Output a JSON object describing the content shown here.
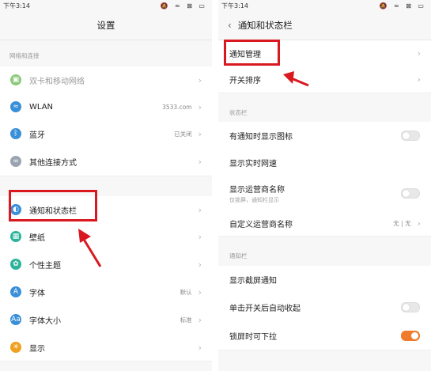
{
  "left": {
    "status": {
      "time": "下午3:14",
      "icons": "🔕 ≈ ⊠ ▭"
    },
    "title": "设置",
    "section_network": "网络和连接",
    "items": [
      {
        "label": "双卡和移动网络",
        "value": "",
        "icon": "sim-icon",
        "color": "#8cc97a"
      },
      {
        "label": "WLAN",
        "value": "3533.com",
        "icon": "wifi-icon",
        "color": "#3a8fd9"
      },
      {
        "label": "蓝牙",
        "value": "已关闭",
        "icon": "bluetooth-icon",
        "color": "#3a8fd9"
      },
      {
        "label": "其他连接方式",
        "value": "",
        "icon": "link-icon",
        "color": "#9aa4b0"
      },
      {
        "label": "通知和状态栏",
        "value": "",
        "icon": "notification-icon",
        "color": "#3a8fd9"
      },
      {
        "label": "壁纸",
        "value": "",
        "icon": "wallpaper-icon",
        "color": "#2cb39a"
      },
      {
        "label": "个性主题",
        "value": "",
        "icon": "theme-icon",
        "color": "#2cb39a"
      },
      {
        "label": "字体",
        "value": "默认",
        "icon": "font-icon",
        "color": "#3a8fd9"
      },
      {
        "label": "字体大小",
        "value": "标准",
        "icon": "font-size-icon",
        "color": "#3a8fd9"
      },
      {
        "label": "显示",
        "value": "",
        "icon": "display-icon",
        "color": "#f0a020"
      }
    ]
  },
  "right": {
    "status": {
      "time": "下午3:14",
      "icons": "🔕 ≈ ⊠ ▭"
    },
    "title": "通知和状态栏",
    "rows_top": [
      {
        "label": "通知管理"
      },
      {
        "label": "开关排序"
      }
    ],
    "section_statusbar": "状态栏",
    "rows_statusbar": [
      {
        "label": "有通知时显示图标",
        "sub": "",
        "value": "",
        "toggle": "off"
      },
      {
        "label": "显示实时网速",
        "sub": "",
        "value": "",
        "toggle": ""
      },
      {
        "label": "显示运营商名称",
        "sub": "仅锁屏，通知栏显示",
        "value": "",
        "toggle": "off"
      },
      {
        "label": "自定义运营商名称",
        "sub": "",
        "value": "无 | 无",
        "toggle": ""
      }
    ],
    "section_notification": "通知栏",
    "rows_notification": [
      {
        "label": "显示截屏通知",
        "toggle": ""
      },
      {
        "label": "单击开关后自动收起",
        "toggle": "off"
      },
      {
        "label": "锁屏时可下拉",
        "toggle": "on"
      }
    ]
  },
  "annotation_color": "#d9191f"
}
